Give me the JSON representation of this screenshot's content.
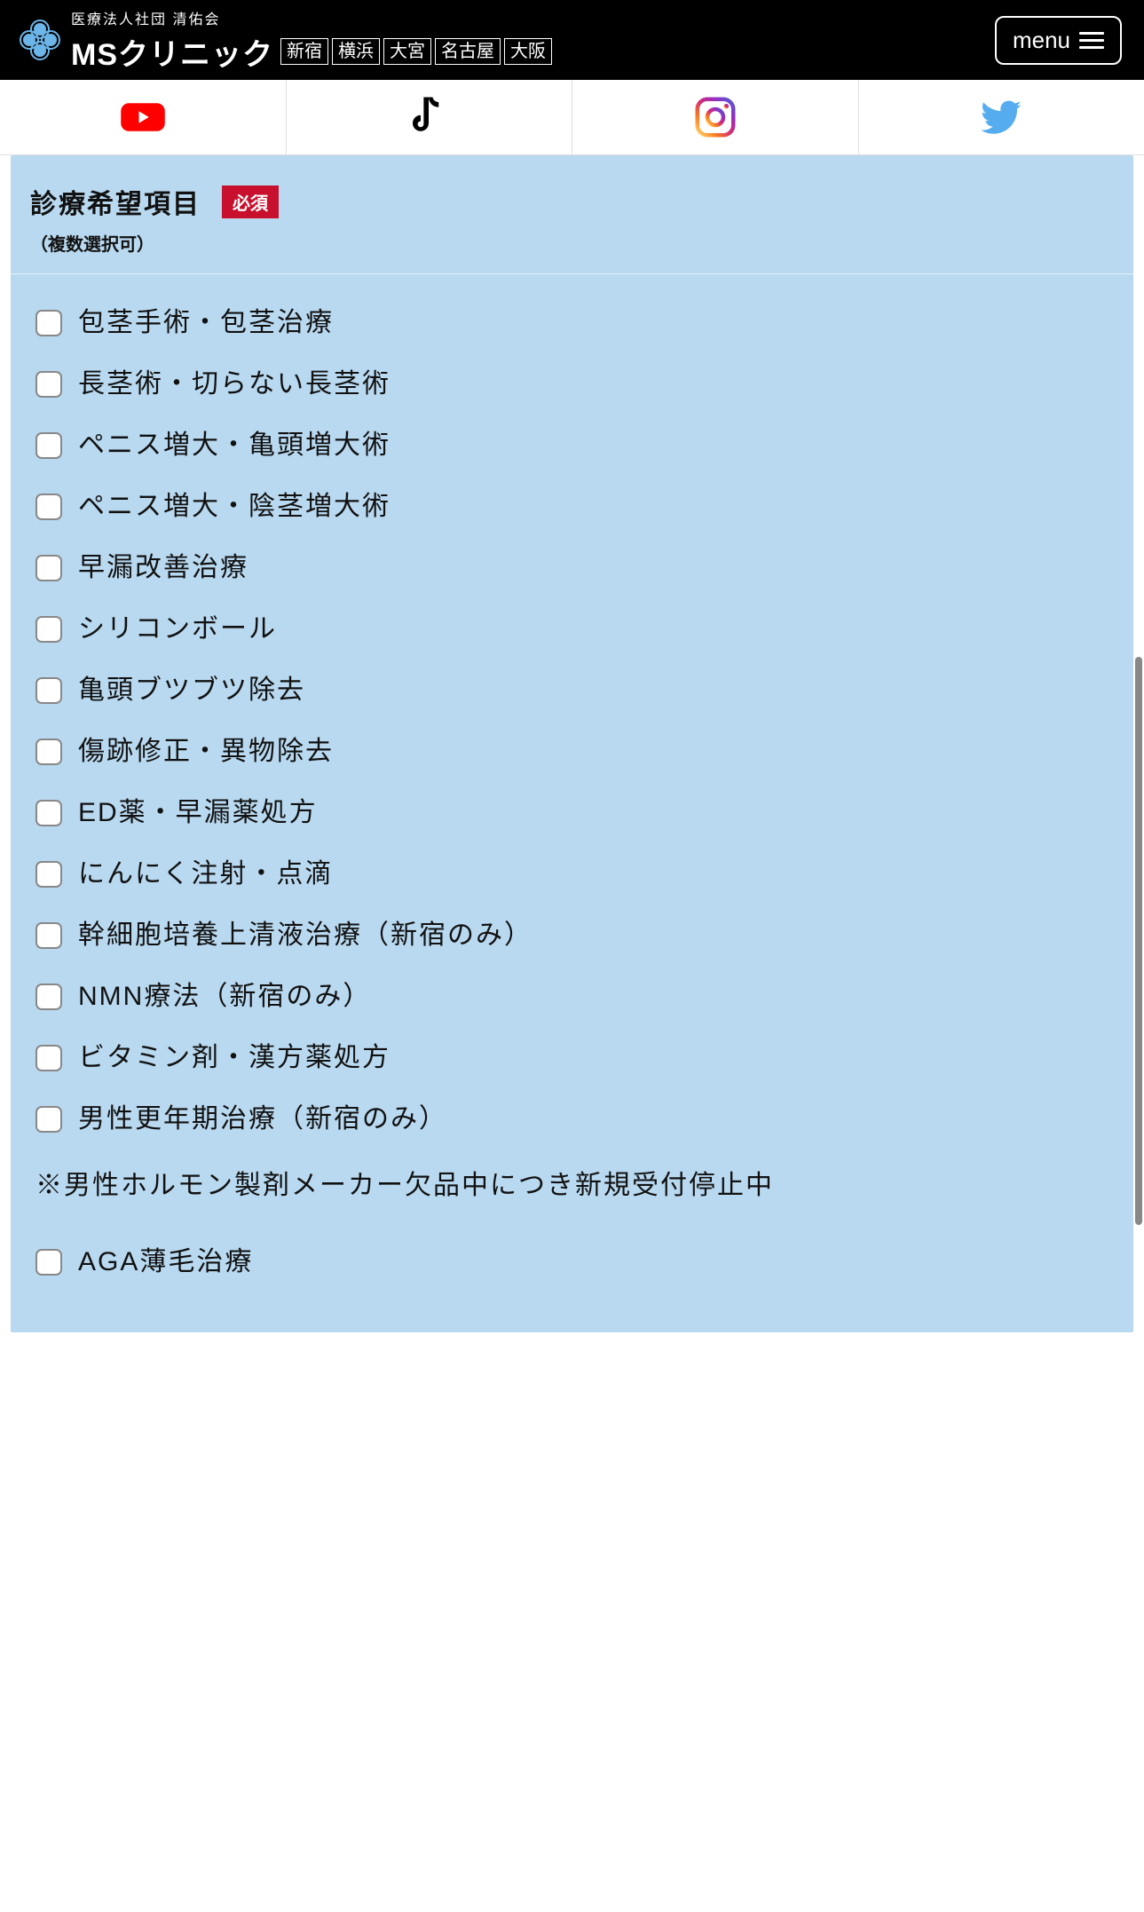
{
  "header": {
    "subtitle": "医療法人社団 清佑会",
    "name": "MSクリニック",
    "locations": [
      "新宿",
      "横浜",
      "大宮",
      "名古屋",
      "大阪"
    ],
    "menu_label": "menu"
  },
  "form": {
    "section_title": "診療希望項目",
    "required_label": "必須",
    "section_subtitle": "（複数選択可）",
    "options": [
      "包茎手術・包茎治療",
      "長茎術・切らない長茎術",
      "ペニス増大・亀頭増大術",
      "ペニス増大・陰茎増大術",
      "早漏改善治療",
      "シリコンボール",
      "亀頭ブツブツ除去",
      "傷跡修正・異物除去",
      "ED薬・早漏薬処方",
      "にんにく注射・点滴",
      "幹細胞培養上清液治療（新宿のみ）",
      "NMN療法（新宿のみ）",
      "ビタミン剤・漢方薬処方",
      "男性更年期治療（新宿のみ）"
    ],
    "note": "※男性ホルモン製剤メーカー欠品中につき新規受付停止中",
    "options_after_note": [
      "AGA薄毛治療"
    ]
  }
}
